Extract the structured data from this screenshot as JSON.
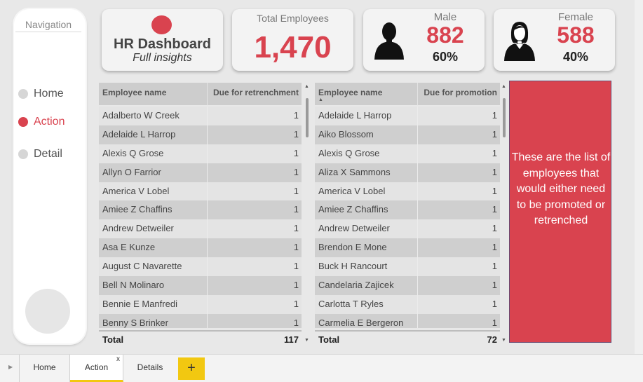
{
  "navigation": {
    "title": "Navigation",
    "items": [
      {
        "label": "Home"
      },
      {
        "label": "Action"
      },
      {
        "label": "Detail"
      }
    ]
  },
  "header_card": {
    "title": "HR Dashboard",
    "subtitle": "Full insights"
  },
  "total_card": {
    "label": "Total Employees",
    "value": "1,470"
  },
  "male_card": {
    "label": "Male",
    "value": "882",
    "percent": "60%"
  },
  "female_card": {
    "label": "Female",
    "value": "588",
    "percent": "40%"
  },
  "retrenchment_table": {
    "headers": [
      "Employee name",
      "Due for retrenchment"
    ],
    "rows": [
      [
        "Adalberto W Creek",
        "1"
      ],
      [
        "Adelaide L Harrop",
        "1"
      ],
      [
        "Alexis Q Grose",
        "1"
      ],
      [
        "Allyn O Farrior",
        "1"
      ],
      [
        "America V Lobel",
        "1"
      ],
      [
        "Amiee Z Chaffins",
        "1"
      ],
      [
        "Andrew Detweiler",
        "1"
      ],
      [
        "Asa E Kunze",
        "1"
      ],
      [
        "August C Navarette",
        "1"
      ],
      [
        "Bell N Molinaro",
        "1"
      ],
      [
        "Bennie E Manfredi",
        "1"
      ],
      [
        "Benny S Brinker",
        "1"
      ]
    ],
    "total_label": "Total",
    "total_value": "117"
  },
  "promotion_table": {
    "headers": [
      "Employee name",
      "Due for promotion"
    ],
    "rows": [
      [
        "Adelaide L Harrop",
        "1"
      ],
      [
        "Aiko Blossom",
        "1"
      ],
      [
        "Alexis Q Grose",
        "1"
      ],
      [
        "Aliza X Sammons",
        "1"
      ],
      [
        "America V Lobel",
        "1"
      ],
      [
        "Amiee Z Chaffins",
        "1"
      ],
      [
        "Andrew Detweiler",
        "1"
      ],
      [
        "Brendon E Mone",
        "1"
      ],
      [
        "Buck H Rancourt",
        "1"
      ],
      [
        "Candelaria Zajicek",
        "1"
      ],
      [
        "Carlotta T Ryles",
        "1"
      ],
      [
        "Carmelia E Bergeron",
        "1"
      ]
    ],
    "total_label": "Total",
    "total_value": "72"
  },
  "info_box": {
    "text": "These are the list of employees that would either need to be promoted or retrenched"
  },
  "page_tabs": [
    {
      "label": "Home"
    },
    {
      "label": "Action"
    },
    {
      "label": "Details"
    }
  ],
  "tab_close": "x",
  "tab_add": "+",
  "colors": {
    "accent": "#d9434f",
    "tab_accent": "#f2c811"
  }
}
